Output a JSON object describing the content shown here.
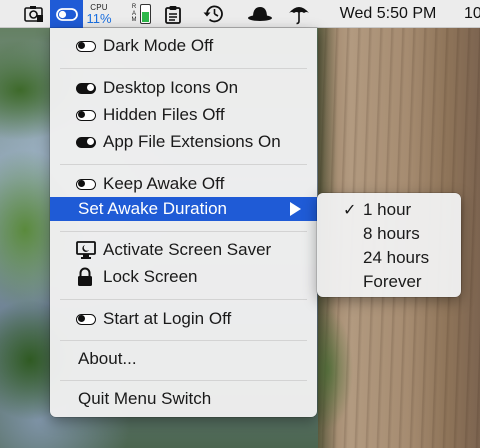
{
  "menubar": {
    "clock": "Wed 5:50 PM",
    "clock_overflow": "10",
    "cpu_label": "CPU",
    "cpu_value": "11%",
    "ram_label": [
      "R",
      "A",
      "M"
    ],
    "ram_level": 0.55,
    "icons": [
      "screenshot-icon",
      "menu-switch-toggle-icon",
      "cpu-meter",
      "ram-meter",
      "clipboard-icon",
      "time-machine-icon",
      "bowler-hat-icon",
      "umbrella-icon"
    ]
  },
  "menu": {
    "items": [
      {
        "label": "Dark Mode Off",
        "icon": "toggle-off"
      },
      {
        "label": "Desktop Icons On",
        "icon": "toggle-on"
      },
      {
        "label": "Hidden Files Off",
        "icon": "toggle-off"
      },
      {
        "label": "App File Extensions On",
        "icon": "toggle-on"
      },
      {
        "label": "Keep Awake Off",
        "icon": "toggle-off"
      },
      {
        "label": "Set Awake Duration",
        "icon": "none",
        "submenu": true
      },
      {
        "label": "Activate Screen Saver",
        "icon": "screen-saver-icon"
      },
      {
        "label": "Lock Screen",
        "icon": "lock-icon"
      },
      {
        "label": "Start at Login Off",
        "icon": "toggle-off"
      },
      {
        "label": "About...",
        "icon": "none"
      },
      {
        "label": "Quit Menu Switch",
        "icon": "none"
      }
    ]
  },
  "submenu": {
    "items": [
      {
        "label": "1 hour",
        "checked": "✓"
      },
      {
        "label": "8 hours",
        "checked": ""
      },
      {
        "label": "24 hours",
        "checked": ""
      },
      {
        "label": "Forever",
        "checked": ""
      }
    ]
  },
  "colors": {
    "highlight": "#1f5bd6",
    "cpu_text": "#1a6fe0",
    "ram_fill": "#2eb84b",
    "menubar_bg": "#ececec"
  }
}
